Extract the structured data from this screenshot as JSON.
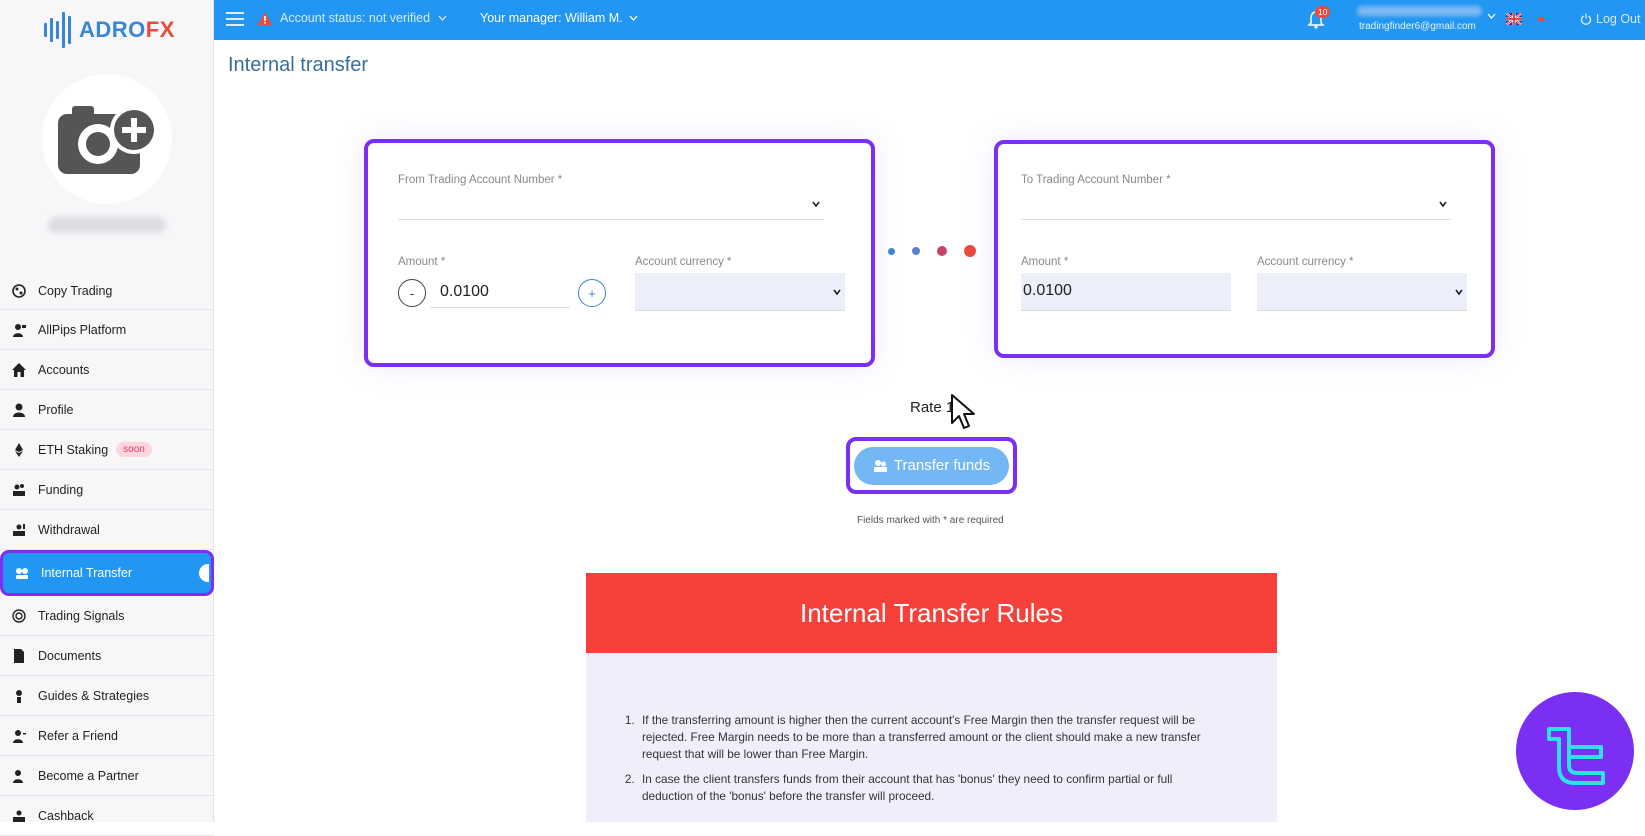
{
  "brand": {
    "name_part1": "ADRO",
    "name_part2": "FX"
  },
  "topbar": {
    "account_status": "Account status: not verified",
    "manager": "Your manager: William M.",
    "notification_count": "10",
    "email": "tradingfinder6@gmail.com",
    "logout": "Log Out"
  },
  "sidebar": {
    "items": [
      {
        "label": "Copy Trading",
        "icon": "copy-trading-icon"
      },
      {
        "label": "AllPips Platform",
        "icon": "allpips-icon"
      },
      {
        "label": "Accounts",
        "icon": "home-icon"
      },
      {
        "label": "Profile",
        "icon": "user-icon"
      },
      {
        "label": "ETH Staking",
        "icon": "ethereum-icon",
        "badge": "soon"
      },
      {
        "label": "Funding",
        "icon": "funding-icon"
      },
      {
        "label": "Withdrawal",
        "icon": "withdrawal-icon"
      },
      {
        "label": "Internal Transfer",
        "icon": "transfer-icon",
        "active": true
      },
      {
        "label": "Trading Signals",
        "icon": "signals-icon"
      },
      {
        "label": "Documents",
        "icon": "document-icon"
      },
      {
        "label": "Guides & Strategies",
        "icon": "guides-icon"
      },
      {
        "label": "Refer a Friend",
        "icon": "refer-icon"
      },
      {
        "label": "Become a Partner",
        "icon": "partner-icon"
      },
      {
        "label": "Cashback",
        "icon": "cashback-icon"
      }
    ]
  },
  "page": {
    "title": "Internal transfer"
  },
  "from": {
    "account_label": "From Trading Account Number *",
    "amount_label": "Amount *",
    "amount_value": "0.0100",
    "currency_label": "Account currency *",
    "minus": "-",
    "plus": "+"
  },
  "to": {
    "account_label": "To Trading Account Number *",
    "amount_label": "Amount *",
    "amount_value": "0.0100",
    "currency_label": "Account currency *"
  },
  "rate_label": "Rate 1",
  "transfer_button": "Transfer funds",
  "required_note": "Fields marked with * are required",
  "rules": {
    "title": "Internal Transfer Rules",
    "items": [
      "If the transferring amount is higher then the current account's Free Margin then the transfer request will be rejected. Free Margin needs to be more than a transferred amount or the client should make a new transfer request that will be lower than Free Margin.",
      "In case the client transfers funds from their account that has 'bonus' they need to confirm partial or full deduction of the 'bonus' before the transfer will proceed."
    ]
  },
  "colors": {
    "accent": "#2196f3",
    "highlight": "#7a2ff2",
    "rules_header": "#f5413a"
  }
}
